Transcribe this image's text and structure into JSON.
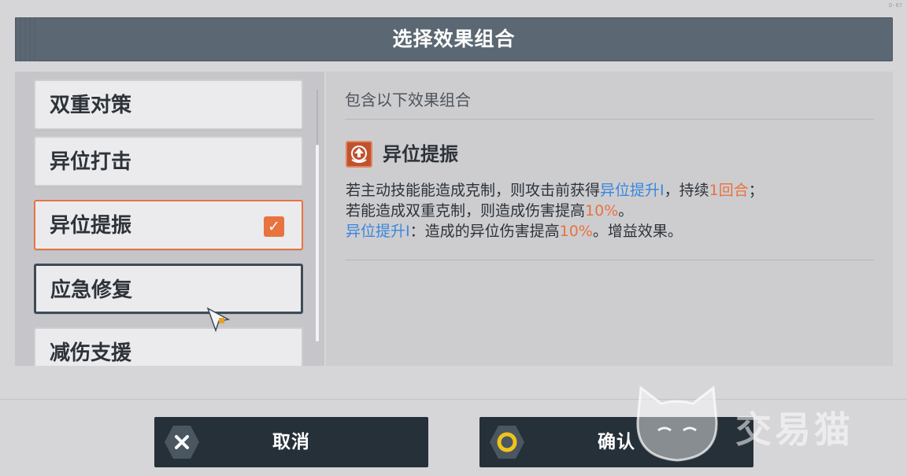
{
  "corner_code": "D-67",
  "title": "选择效果组合",
  "list": {
    "items": [
      {
        "label": "双重对策",
        "state": "normal"
      },
      {
        "label": "异位打击",
        "state": "normal"
      },
      {
        "label": "异位提振",
        "state": "selected"
      },
      {
        "label": "应急修复",
        "state": "hover"
      },
      {
        "label": "减伤支援",
        "state": "normal"
      }
    ]
  },
  "detail": {
    "heading": "包含以下效果组合",
    "effect": {
      "icon": "arrow-up-emblem-icon",
      "title": "异位提振",
      "desc": {
        "l1_a": "若主动技能能造成克制，则攻击前获得",
        "l1_b": "异位提升I",
        "l1_c": "，持续",
        "l1_d": "1回合",
        "l1_e": "；",
        "l2_a": "若能造成双重克制，则造成伤害提高",
        "l2_b": "10%",
        "l2_c": "。",
        "l3_a": "异位提升I",
        "l3_b": "：造成的异位伤害提高",
        "l3_c": "10%",
        "l3_d": "。增益效果。"
      }
    }
  },
  "buttons": {
    "cancel": "取消",
    "confirm": "确认"
  },
  "watermark": "交易猫",
  "colors": {
    "accent_orange": "#e8733f",
    "highlight_blue": "#3a86de",
    "title_bar": "#5b6772",
    "button_bg": "#263038"
  }
}
